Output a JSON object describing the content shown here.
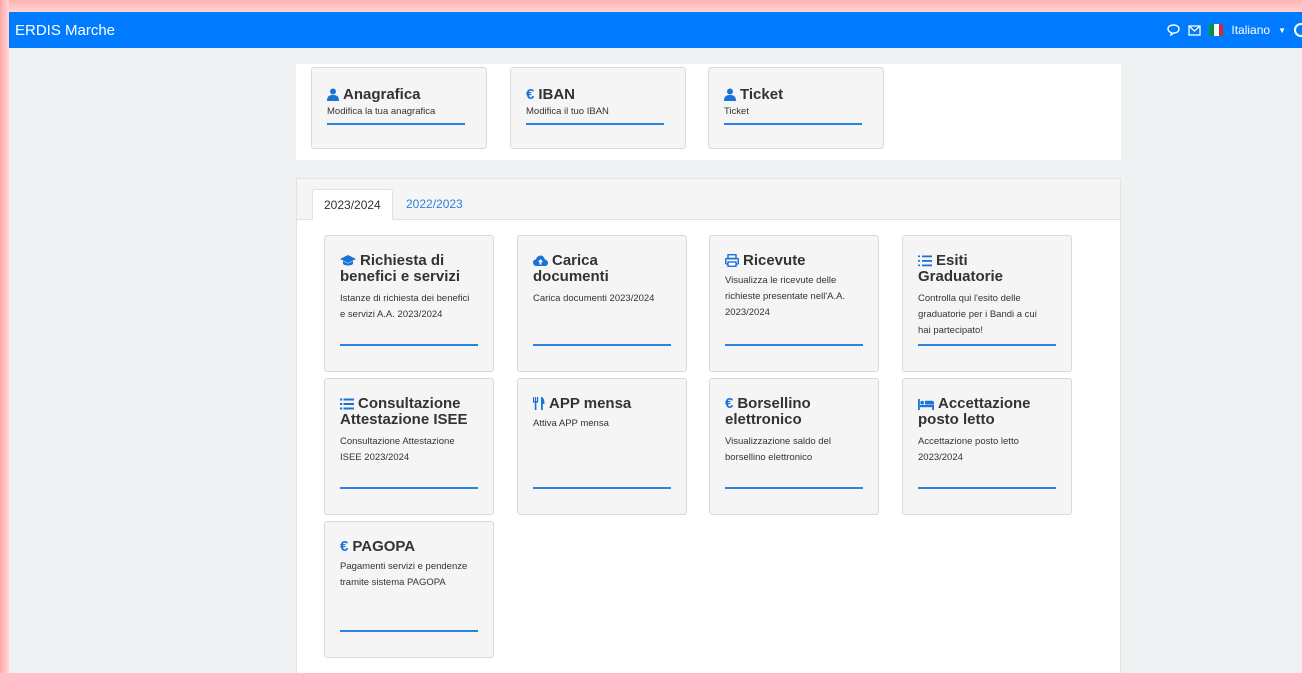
{
  "app": {
    "brand": "ERDIS Marche"
  },
  "navbar": {
    "language": "Italiano"
  },
  "profile_cards": [
    {
      "title": "Anagrafica",
      "icon": "user-icon",
      "description": "Modifica la tua anagrafica"
    },
    {
      "title": "IBAN",
      "icon": "euro-icon",
      "description": "Modifica il tuo IBAN"
    },
    {
      "title": "Ticket",
      "icon": "user-icon",
      "description": "Ticket"
    }
  ],
  "tabs": [
    {
      "label": "2023/2024",
      "active": true
    },
    {
      "label": "2022/2023",
      "active": false
    }
  ],
  "service_cards": [
    {
      "title_l1": "Richiesta di",
      "title_l2": "benefici e servizi",
      "icon": "graduation-cap-icon",
      "desc_l1": "Istanze di richiesta dei benefici",
      "desc_l2": "e servizi A.A. 2023/2024",
      "desc_l3": "",
      "desc_l4": ""
    },
    {
      "title_l1": "Carica",
      "title_l2": "documenti",
      "icon": "cloud-upload-icon",
      "desc_l1": "Carica documenti 2023/2024",
      "desc_l2": "",
      "desc_l3": "",
      "desc_l4": ""
    },
    {
      "title_l1": "Ricevute",
      "title_l2": "",
      "icon": "printer-icon",
      "desc_l1": "Visualizza le ricevute delle",
      "desc_l2": "richieste presentate nell'A.A.",
      "desc_l3": "2023/2024",
      "desc_l4": ""
    },
    {
      "title_l1": "Esiti",
      "title_l2": "Graduatorie",
      "icon": "list-ol-icon",
      "desc_l1": "Controlla qui l'esito delle",
      "desc_l2": "graduatorie per i Bandi a cui",
      "desc_l3": "hai partecipato!",
      "desc_l4": ""
    },
    {
      "title_l1": "Consultazione",
      "title_l2": "Attestazione ISEE",
      "icon": "list-icon",
      "desc_l1": "Consultazione Attestazione",
      "desc_l2": "ISEE 2023/2024",
      "desc_l3": "",
      "desc_l4": ""
    },
    {
      "title_l1": "APP mensa",
      "title_l2": "",
      "icon": "utensils-icon",
      "desc_l1": "Attiva APP mensa",
      "desc_l2": "",
      "desc_l3": "",
      "desc_l4": ""
    },
    {
      "title_l1": "Borsellino",
      "title_l2": "elettronico",
      "icon": "euro-icon",
      "desc_l1": "Visualizzazione saldo del",
      "desc_l2": "borsellino elettronico",
      "desc_l3": "",
      "desc_l4": ""
    },
    {
      "title_l1": "Accettazione",
      "title_l2": "posto letto",
      "icon": "bed-icon",
      "desc_l1": "Accettazione posto letto",
      "desc_l2": "2023/2024",
      "desc_l3": "",
      "desc_l4": ""
    },
    {
      "title_l1": "PAGOPA",
      "title_l2": "",
      "icon": "euro-icon",
      "desc_l1": "Pagamenti servizi e pendenze",
      "desc_l2": "tramite sistema PAGOPA",
      "desc_l3": "",
      "desc_l4": ""
    }
  ],
  "colors": {
    "navbar": "#007bff",
    "accent": "#1b73d8",
    "flag": [
      "#009246",
      "#ffffff",
      "#ce2b37"
    ]
  }
}
